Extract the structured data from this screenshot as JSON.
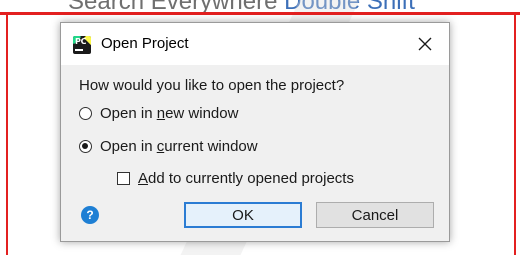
{
  "background": {
    "hint_text": "Search Everywhere",
    "hint_shortcut": "Double Shift"
  },
  "dialog": {
    "title": "Open Project",
    "app_icon": "pycharm-icon",
    "close_icon": "close-icon",
    "question": "How would you like to open the project?",
    "options": [
      {
        "label_pre": "Open in ",
        "mnemonic": "n",
        "label_post": "ew window",
        "checked": false
      },
      {
        "label_pre": "Open in ",
        "mnemonic": "c",
        "label_post": "urrent window",
        "checked": true
      }
    ],
    "attach": {
      "mnemonic": "A",
      "label_post": "dd to currently opened projects",
      "checked": false
    },
    "help_label": "?",
    "ok_label": "OK",
    "cancel_label": "Cancel"
  },
  "colors": {
    "highlight_border": "#e32020",
    "ok_border": "#2b7cd3",
    "help_blue": "#1e7fd4"
  }
}
